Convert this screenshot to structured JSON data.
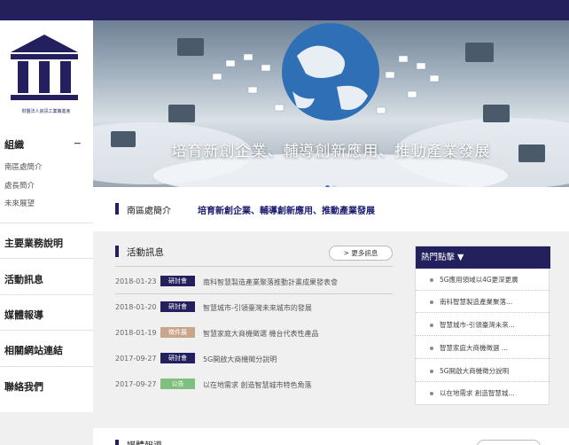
{
  "logo": {
    "caption": "財團法人資訊工業策進會"
  },
  "sidebar": {
    "section_title": "組織",
    "section_toggle": "−",
    "items": [
      {
        "label": "南區處簡介"
      },
      {
        "label": "處長簡介"
      },
      {
        "label": "未來展望"
      }
    ],
    "nav": [
      {
        "label": "主要業務說明"
      },
      {
        "label": "活動訊息"
      },
      {
        "label": "媒體報導"
      },
      {
        "label": "相關網站連結"
      },
      {
        "label": "聯絡我們"
      }
    ]
  },
  "hero": {
    "tagline": "培育新創企業、輔導創新應用、推動產業發展"
  },
  "breadcrumb": {
    "home": "南區處簡介",
    "current": "培育新創企業、輔導創新應用、推動產業發展"
  },
  "news": {
    "title": "活動訊息",
    "more_label": "> 更多訊息",
    "rows": [
      {
        "date": "2018-01-23",
        "tag": "研討會",
        "tag_color": "#24205e",
        "text": "南科智慧製造產業聚落推動計畫成果發表會"
      },
      {
        "date": "2018-01-20",
        "tag": "研討會",
        "tag_color": "#24205e",
        "text": "智慧城市-引領臺灣未來城市的發展"
      },
      {
        "date": "2018-01-19",
        "tag": "徵件展",
        "tag_color": "#c9a58c",
        "text": "智慧家庭大商機徵選 機台代表性產品"
      },
      {
        "date": "2017-09-27",
        "tag": "研討會",
        "tag_color": "#24205e",
        "text": "5G開啟大商機徵分說明"
      },
      {
        "date": "2017-09-27",
        "tag": "公告",
        "tag_color": "#7fbf7f",
        "text": "以在地需求 創造智慧城市特色角落"
      }
    ]
  },
  "hot": {
    "title": "熱門點擊 ▼",
    "items": [
      {
        "label": "5G應用領域以4G更深更廣"
      },
      {
        "label": "南科智慧製造產業聚落..."
      },
      {
        "label": "智慧城市-引領臺灣未來..."
      },
      {
        "label": "智慧家庭大商機徵選 ..."
      },
      {
        "label": "5G開啟大商機徵分說明"
      },
      {
        "label": "以在地需求 創造智慧城..."
      }
    ]
  },
  "bottom": {
    "title": "媒體報導"
  }
}
